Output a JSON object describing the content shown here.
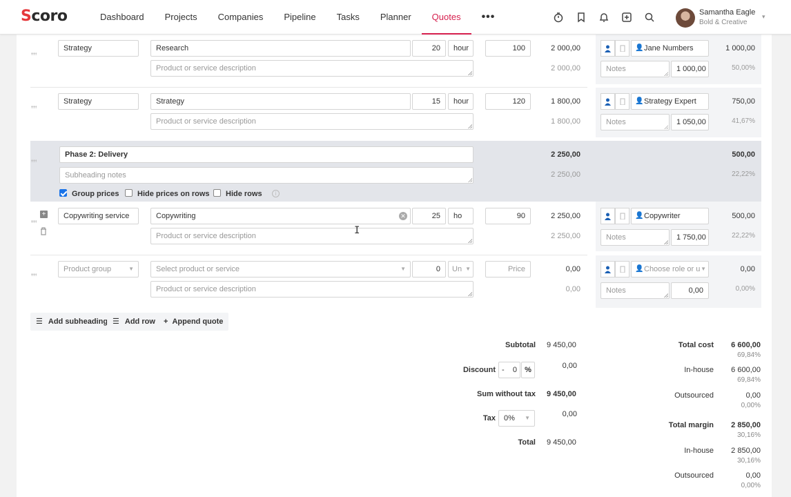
{
  "app": {
    "logo": "Scoro",
    "accent": "#d6204e"
  },
  "nav": {
    "items": [
      "Dashboard",
      "Projects",
      "Companies",
      "Pipeline",
      "Tasks",
      "Planner",
      "Quotes"
    ],
    "active": "Quotes",
    "more": "•••"
  },
  "user": {
    "name": "Samantha Eagle",
    "company": "Bold & Creative"
  },
  "rows": [
    {
      "group": "Strategy",
      "product": "Research",
      "description_placeholder": "Product or service description",
      "qty": "20",
      "unit": "hour",
      "price": "100",
      "sum": "2 000,00",
      "sum_sub": "2 000,00",
      "role": "Jane Numbers",
      "notes_placeholder": "Notes",
      "cost": "1 000,00",
      "margin": "1 000,00",
      "margin_pct": "50,00%"
    },
    {
      "group": "Strategy",
      "product": "Strategy",
      "description_placeholder": "Product or service description",
      "qty": "15",
      "unit": "hour",
      "price": "120",
      "sum": "1 800,00",
      "sum_sub": "1 800,00",
      "role": "Strategy Expert",
      "notes_placeholder": "Notes",
      "cost": "1 050,00",
      "margin": "750,00",
      "margin_pct": "41,67%"
    },
    {
      "group": "Copywriting service",
      "product": "Copywriting",
      "description_placeholder": "Product or service description",
      "qty": "25",
      "unit": "ho",
      "price": "90",
      "sum": "2 250,00",
      "sum_sub": "2 250,00",
      "role": "Copywriter",
      "notes_placeholder": "Notes",
      "cost": "1 750,00",
      "margin": "500,00",
      "margin_pct": "22,22%"
    },
    {
      "group": "Product group",
      "product": "Select product or service",
      "description_placeholder": "Product or service description",
      "qty": "0",
      "unit": "Un",
      "price": "Price",
      "sum": "0,00",
      "sum_sub": "0,00",
      "role": "Choose role or u",
      "notes_placeholder": "Notes",
      "cost": "0,00",
      "margin": "0,00",
      "margin_pct": "0,00%"
    }
  ],
  "phase": {
    "title": "Phase 2: Delivery",
    "notes_placeholder": "Subheading notes",
    "sum": "2 250,00",
    "sum_sub": "2 250,00",
    "margin": "500,00",
    "margin_pct": "22,22%",
    "group_prices_label": "Group prices",
    "group_prices_checked": true,
    "hide_prices_label": "Hide prices on rows",
    "hide_rows_label": "Hide rows"
  },
  "actions": {
    "add_subheading": "Add subheading",
    "add_row": "Add row",
    "append_quote": "Append quote"
  },
  "totals": {
    "subtotal_label": "Subtotal",
    "subtotal": "9 450,00",
    "discount_label": "Discount",
    "discount_sign": "-",
    "discount_value": "0",
    "discount_unit": "%",
    "discount_amount": "0,00",
    "sum_without_tax_label": "Sum without tax",
    "sum_without_tax": "9 450,00",
    "tax_label": "Tax",
    "tax_value": "0%",
    "tax_amount": "0,00",
    "total_label": "Total",
    "total": "9 450,00"
  },
  "costs": {
    "total_cost_label": "Total cost",
    "total_cost": "6 600,00",
    "total_cost_pct": "69,84%",
    "inhouse_label": "In-house",
    "inhouse": "6 600,00",
    "inhouse_pct": "69,84%",
    "outsourced_label": "Outsourced",
    "outsourced": "0,00",
    "outsourced_pct": "0,00%",
    "total_margin_label": "Total margin",
    "total_margin": "2 850,00",
    "total_margin_pct": "30,16%",
    "margin_inhouse_label": "In-house",
    "margin_inhouse": "2 850,00",
    "margin_inhouse_pct": "30,16%",
    "margin_outsourced_label": "Outsourced",
    "margin_outsourced": "0,00",
    "margin_outsourced_pct": "0,00%"
  }
}
